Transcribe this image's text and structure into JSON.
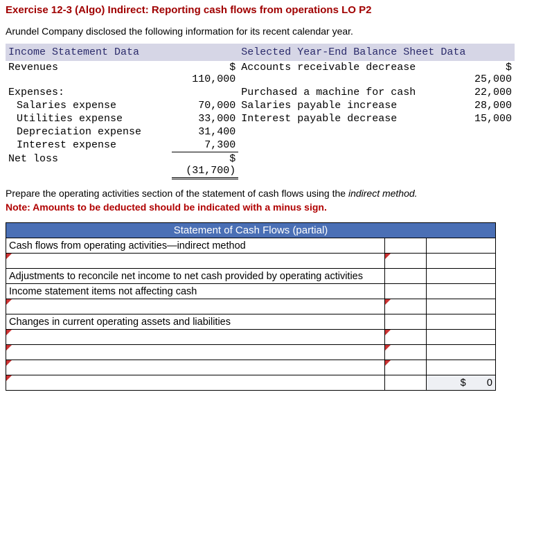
{
  "title": "Exercise 12-3 (Algo) Indirect: Reporting cash flows from operations LO P2",
  "intro": "Arundel Company disclosed the following information for its recent calendar year.",
  "income_header": "Income Statement Data",
  "balance_header": "Selected Year-End Balance Sheet Data",
  "income": {
    "rev_label": "Revenues",
    "rev_amt": "$\n110,000",
    "exp_label": "Expenses:",
    "sal_label": "Salaries expense",
    "sal_amt": "70,000",
    "util_label": "Utilities expense",
    "util_amt": "33,000",
    "dep_label": "Depreciation expense",
    "dep_amt": "31,400",
    "int_label": "Interest expense",
    "int_amt": "7,300",
    "net_label": "Net loss",
    "net_amt": "$\n(31,700)"
  },
  "balance": {
    "ar_label": "Accounts receivable decrease",
    "ar_amt": "$\n25,000",
    "mach_label": "Purchased a machine for cash",
    "mach_amt": "22,000",
    "sp_label": "Salaries payable increase",
    "sp_amt": "28,000",
    "ip_label": "Interest payable decrease",
    "ip_amt": "15,000"
  },
  "instruction": "Prepare the operating activities section of the statement of cash flows using the ",
  "instruction_em": "indirect method.",
  "note": "Note: Amounts to be deducted should be indicated with a minus sign.",
  "cf": {
    "header": "Statement of Cash Flows (partial)",
    "row1": "Cash flows from operating activities—indirect method",
    "row3": "Adjustments to reconcile net income to net cash provided by operating activities",
    "row4": "Income statement items not affecting cash",
    "row6": "Changes in current operating assets and liabilities",
    "total_sym": "$",
    "total_val": "0"
  }
}
